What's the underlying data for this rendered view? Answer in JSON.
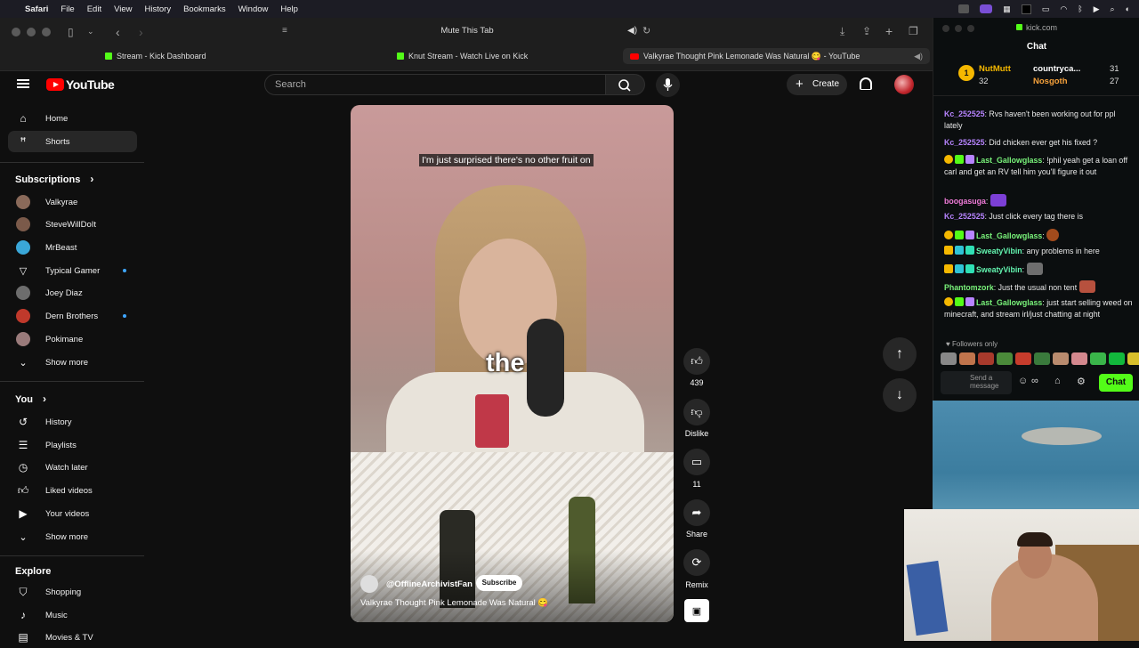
{
  "menubar": {
    "apple": "",
    "items": [
      "Safari",
      "File",
      "Edit",
      "View",
      "History",
      "Bookmarks",
      "Window",
      "Help"
    ]
  },
  "safari": {
    "address": "Mute This Tab",
    "tabs": [
      {
        "label": "Stream - Kick Dashboard"
      },
      {
        "label": "Knut Stream - Watch Live on Kick"
      },
      {
        "label": "Valkyrae Thought Pink Lemonade Was Natural 😋 - YouTube"
      }
    ]
  },
  "youtube": {
    "logo_text": "YouTube",
    "search_placeholder": "Search",
    "create_label": "Create",
    "sidebar": {
      "home": "Home",
      "shorts": "Shorts",
      "subscriptions_header": "Subscriptions",
      "channels": [
        {
          "name": "Valkyrae",
          "color": "#8a6a5a",
          "live": false
        },
        {
          "name": "SteveWillDoIt",
          "color": "#7b5a4a",
          "live": false
        },
        {
          "name": "MrBeast",
          "color": "#3aa7d8",
          "live": false
        },
        {
          "name": "Typical Gamer",
          "color": "#222222",
          "live": true
        },
        {
          "name": "Joey Diaz",
          "color": "#6d6d6d",
          "live": false
        },
        {
          "name": "Dern Brothers",
          "color": "#c0392b",
          "live": true
        },
        {
          "name": "Pokimane",
          "color": "#9a7b7b",
          "live": false
        }
      ],
      "show_more_1": "Show more",
      "you_header": "You",
      "you_items": [
        "History",
        "Playlists",
        "Watch later",
        "Liked videos",
        "Your videos"
      ],
      "show_more_2": "Show more",
      "explore_header": "Explore",
      "explore_items": [
        "Shopping",
        "Music",
        "Movies & TV"
      ]
    },
    "short": {
      "caption_top": "I'm just surprised there's no other fruit on",
      "caption_big": "the",
      "channel": "@OfflineArchivistFan",
      "subscribe": "Subscribe",
      "title": "Valkyrae Thought Pink Lemonade Was Natural 😋"
    },
    "actions": {
      "likes": "439",
      "dislike": "Dislike",
      "comments": "11",
      "share": "Share",
      "remix": "Remix"
    }
  },
  "kick": {
    "url": "kick.com",
    "title": "Chat",
    "gifters": [
      {
        "rank": "1",
        "name": "NutMutt",
        "count": "32"
      },
      {
        "name": "countryca...",
        "count": "31"
      },
      {
        "name": "Nosgoth",
        "count": "27"
      }
    ],
    "messages": [
      {
        "user": "Kc_252525",
        "text": "Rvs haven't been working out for ppl lately"
      },
      {
        "user": "Kc_252525",
        "text": "Did chicken ever get his fixed ?"
      },
      {
        "user": "Last_Gallowglass",
        "text": "!phil yeah get a loan off carl and get an RV tell him you'll figure it out"
      },
      {
        "user": "boogasuga",
        "text": ""
      },
      {
        "user": "Kc_252525",
        "text": "Just click every tag there is"
      },
      {
        "user": "Last_Gallowglass",
        "text": ""
      },
      {
        "user": "SweatyVibin",
        "text": "any problems in here"
      },
      {
        "user": "SweatyVibin",
        "text": ""
      },
      {
        "user": "Phantomzork",
        "text": "Just the usual non tent"
      },
      {
        "user": "Last_Gallowglass",
        "text": "just start selling weed on minecraft, and stream irl/just chatting at night"
      }
    ],
    "followers_only": "Followers only",
    "input_placeholder": "Send a message",
    "chat_button": "Chat"
  }
}
